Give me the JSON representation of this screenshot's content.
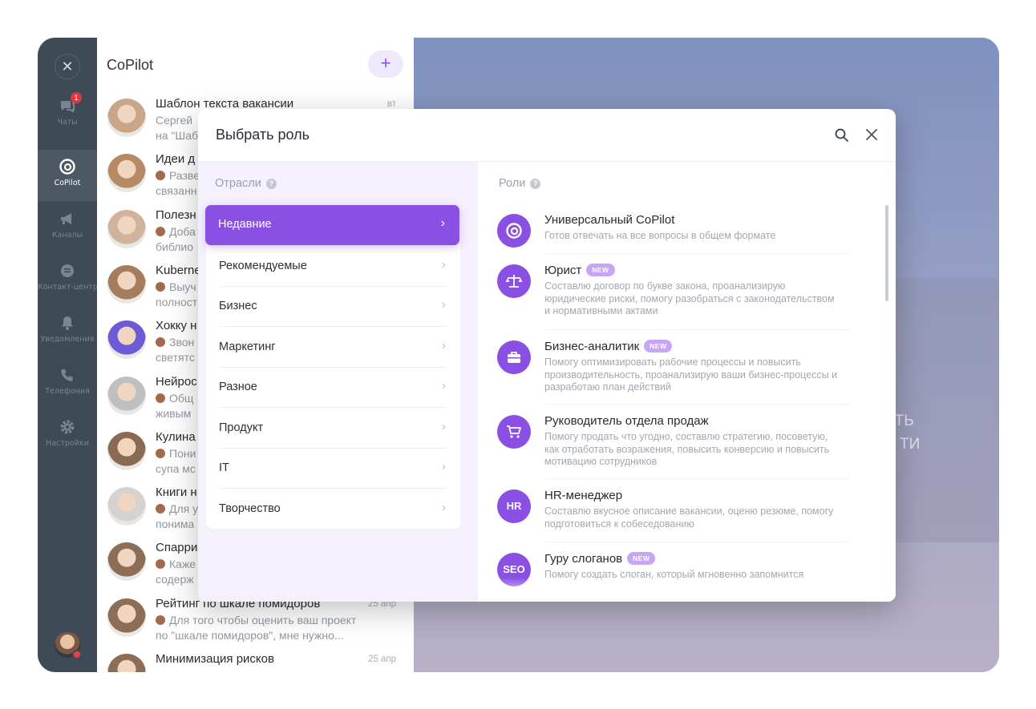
{
  "rail": {
    "items": [
      {
        "label": "Чаты",
        "icon": "chat-icon",
        "badge": "1"
      },
      {
        "label": "CoPilot",
        "icon": "copilot-icon"
      },
      {
        "label": "Каналы",
        "icon": "megaphone-icon"
      },
      {
        "label": "Контакт-центр",
        "icon": "contact-center-icon"
      },
      {
        "label": "Уведомления",
        "icon": "bell-icon"
      },
      {
        "label": "Телефония",
        "icon": "phone-icon"
      },
      {
        "label": "Настройки",
        "icon": "gear-icon"
      }
    ]
  },
  "chats": {
    "title": "CoPilot",
    "add_label": "+",
    "list": [
      {
        "name": "Шаблон текста вакансии",
        "time": "вт",
        "line1": "Сергей",
        "line2": "на \"Шаб",
        "avatar": "#c9a58a"
      },
      {
        "name": "Идеи д",
        "time": "",
        "line1": "Разве",
        "line2": "связанн",
        "avatar": "#b58a64"
      },
      {
        "name": "Полезн",
        "time": "",
        "line1": "Доба",
        "line2": "библио",
        "avatar": "#d1b39d"
      },
      {
        "name": "Kuberne",
        "time": "",
        "line1": "Выуч",
        "line2": "полност",
        "avatar": "#a67c5e"
      },
      {
        "name": "Хокку н",
        "time": "",
        "line1": "Звон",
        "line2": "светятс",
        "avatar": "#6b5bd6"
      },
      {
        "name": "Нейрос",
        "time": "",
        "line1": "Общ",
        "line2": "живым",
        "avatar": "#bfbfbf"
      },
      {
        "name": "Кулина",
        "time": "",
        "line1": "Пони",
        "line2": "супа мс",
        "avatar": "#8a6a52"
      },
      {
        "name": "Книги н",
        "time": "",
        "line1": "Для у",
        "line2": "понима",
        "avatar": "#d6d2cf"
      },
      {
        "name": "Спарри",
        "time": "",
        "line1": "Каже",
        "line2": "содерж",
        "avatar": "#8c6d55"
      },
      {
        "name": "Рейтинг по шкале помидоров",
        "time": "25 апр",
        "line1": "Для того чтобы оценить ваш проект",
        "line2": "по \"шкале помидоров\", мне нужно...",
        "avatar": "#8c6d55"
      },
      {
        "name": "Минимизация рисков",
        "time": "25 апр",
        "line1": "",
        "line2": "",
        "avatar": "#8c6d55"
      }
    ]
  },
  "background": {
    "text1": "ИТЬ",
    "text2": "ТИ"
  },
  "modal": {
    "title": "Выбрать роль",
    "industries_title": "Отрасли",
    "roles_title": "Роли",
    "industries": [
      "Недавние",
      "Рекомендуемые",
      "Бизнес",
      "Маркетинг",
      "Разное",
      "Продукт",
      "IT",
      "Творчество"
    ],
    "active_industry": "Недавние",
    "roles": [
      {
        "name": "Универсальный CoPilot",
        "badge": "",
        "icon_text": "",
        "icon": "copilot-icon",
        "desc": "Готов отвечать на все вопросы в общем формате"
      },
      {
        "name": "Юрист",
        "badge": "NEW",
        "icon_text": "",
        "icon": "scales-icon",
        "desc": "Составлю договор по букве закона, проанализирую юридические риски, помогу разобраться с законодательством и нормативными актами"
      },
      {
        "name": "Бизнес-аналитик",
        "badge": "NEW",
        "icon_text": "",
        "icon": "briefcase-icon",
        "desc": "Помогу оптимизировать рабочие процессы и повысить производительность, проанализирую ваши бизнес-процессы и разработаю план действий"
      },
      {
        "name": "Руководитель отдела продаж",
        "badge": "",
        "icon_text": "",
        "icon": "cart-icon",
        "desc": "Помогу продать что угодно, составлю стратегию, посоветую, как отработать возражения, повысить конверсию и повысить мотивацию сотрудников"
      },
      {
        "name": "HR-менеджер",
        "badge": "",
        "icon_text": "HR",
        "icon": "hr-icon",
        "desc": "Составлю вкусное описание вакансии, оценю резюме, помогу подготовиться к собеседованию"
      },
      {
        "name": "Гуру слоганов",
        "badge": "NEW",
        "icon_text": "SEO",
        "icon": "seo-icon",
        "desc": "Помогу создать слоган, который мгновенно запомнится"
      }
    ]
  }
}
